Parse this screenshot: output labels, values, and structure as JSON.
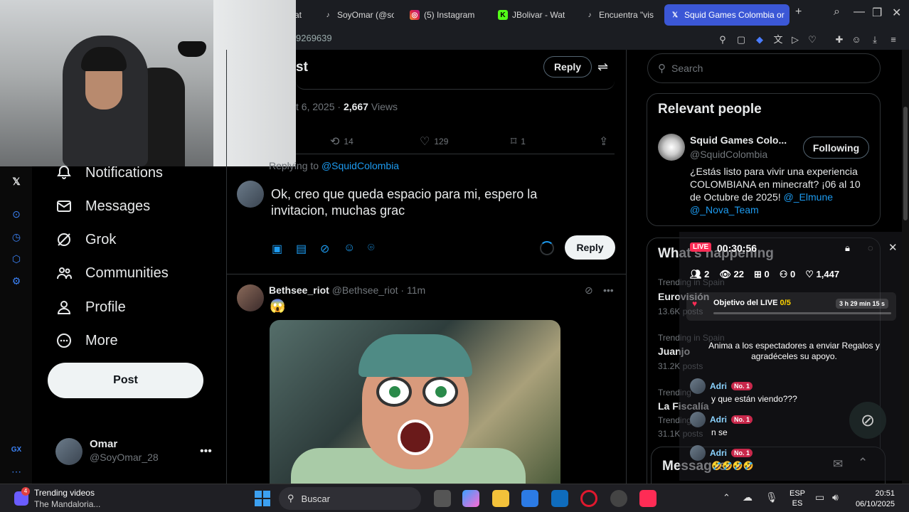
{
  "browser": {
    "tabs": [
      {
        "label": "at",
        "icon": "tiktok-icon"
      },
      {
        "label": "SoyOmar (@so",
        "icon": "tiktok-icon"
      },
      {
        "label": "(5) Instagram",
        "icon": "instagram-icon"
      },
      {
        "label": "JBolivar - Wat",
        "icon": "kick-icon"
      },
      {
        "label": "Encuentra \"vis",
        "icon": "tiktok-icon"
      },
      {
        "label": "Squid Games Colombia or",
        "icon": "x-icon"
      }
    ],
    "address_text": "9269639"
  },
  "nav": {
    "items": [
      "Notifications",
      "Messages",
      "Grok",
      "Communities",
      "Profile",
      "More"
    ],
    "post_label": "Post",
    "account_name": "Omar",
    "account_handle": "@SoyOmar_28"
  },
  "post": {
    "header_partial": "st",
    "header_reply": "Reply",
    "date_partial": "t 6, 2025 ·",
    "views_count": "2,667",
    "views_label": "Views",
    "retweets": "14",
    "likes": "129",
    "bookmarks": "1"
  },
  "composer": {
    "replying_to_label": "Replying to",
    "replying_to_handle": "@SquidColombia",
    "text": "Ok, creo que queda espacio para mi, espero la invitacion, muchas grac",
    "reply_label": "Reply"
  },
  "reply_tweet": {
    "author": "Bethsee_riot",
    "handle": "@Bethsee_riot",
    "time": "· 11m",
    "text": "😱"
  },
  "sidebar": {
    "search_placeholder": "Search",
    "relevant_title": "Relevant people",
    "person_name": "Squid Games Colo...",
    "person_handle": "@SquidColombia",
    "follow_label": "Following",
    "bio_1": "¿Estás listo para vivir una experiencia COLOMBIANA en minecraft? ¡06 al 10 de Octubre de 2025! ",
    "bio_link_1": "@_Elmune",
    "bio_link_2": "@_Nova_Team",
    "happening_title": "What's happening",
    "trends": [
      {
        "sub": "Trending in Spain",
        "name": "Eurovisión",
        "posts": "13.6K posts"
      },
      {
        "sub": "Trending in Spain",
        "name": "Juanjo",
        "posts": "31.2K posts"
      },
      {
        "sub": "Trending",
        "name": "La Fiscalía",
        "posts": "31.1K posts"
      }
    ],
    "sub_2": "Trending",
    "messages_label": "Messages"
  },
  "live": {
    "badge": "LIVE",
    "timer": "00:30:56",
    "stats": {
      "viewers_group": "2",
      "views": "22",
      "gifts": "0",
      "follows": "0",
      "likes": "1,447"
    },
    "goal_label": "Objetivo del LIVE ",
    "goal_value": "0/5",
    "goal_time": "3 h 29 min 15 s",
    "prompt": "Anima a los espectadores a enviar Regalos y agradéceles su apoyo.",
    "chat": [
      {
        "name": "Adri",
        "badge": "No. 1",
        "text": "y que están viendo???"
      },
      {
        "name": "Adri",
        "badge": "No. 1",
        "text": "n se"
      },
      {
        "name": "Adri",
        "badge": "No. 1",
        "text": "🤣🤣🤣🤣"
      }
    ]
  },
  "taskbar": {
    "news_title": "Trending videos",
    "news_sub": "The Mandaloria...",
    "news_count": "4",
    "search_label": "Buscar",
    "lang_1": "ESP",
    "lang_2": "ES",
    "time": "20:51",
    "date": "06/10/2025"
  },
  "colors": {
    "accent": "#1d9bf0",
    "live": "#fe2c55",
    "tab_active": "#3b57d6"
  }
}
